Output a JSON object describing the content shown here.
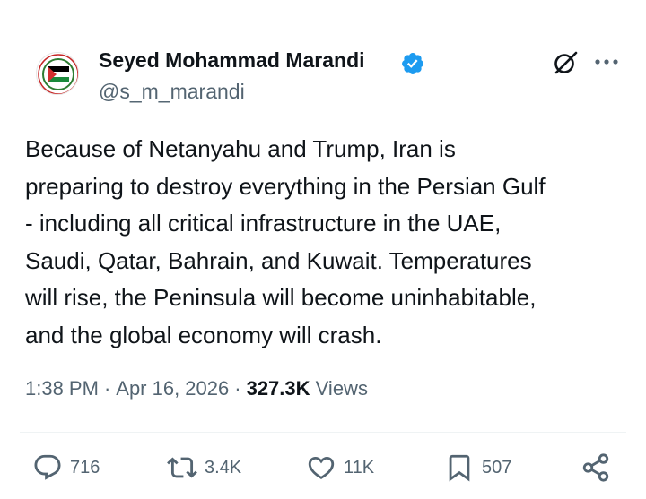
{
  "author": {
    "display_name": "Seyed Mohammad Marandi",
    "handle": "@s_m_marandi",
    "verified": true,
    "avatar_icon": "palestine-flag-badge-icon"
  },
  "header_icons": [
    "grok-icon",
    "more-icon"
  ],
  "tweet": {
    "text": "Because of Netanyahu and Trump, Iran is\npreparing to destroy everything in the Persian Gulf\n- including all critical infrastructure in the UAE,\nSaudi, Qatar, Bahrain, and Kuwait. Temperatures\nwill rise, the Peninsula will become uninhabitable,\nand the global economy will crash."
  },
  "meta": {
    "time": "1:38 PM",
    "separator": "·",
    "date": "Apr 16, 2026",
    "views_count": "327.3K",
    "views_label": "Views"
  },
  "actions": {
    "reply": "716",
    "retweet": "3.4K",
    "like": "11K",
    "bookmark": "507"
  },
  "colors": {
    "text": "#0f1419",
    "secondary": "#536471",
    "verified": "#1d9bf0",
    "divider": "#eff3f4"
  }
}
